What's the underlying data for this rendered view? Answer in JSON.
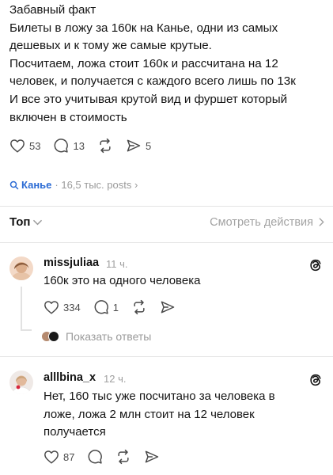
{
  "post": {
    "lines": [
      "Забавный факт",
      "Билеты в ложу за 160к на Канье, одни из самых",
      "дешевых и к тому же самые крутые.",
      "Посчитаем, ложа стоит 160к и рассчитана на 12",
      "человек, и получается с каждого всего лишь по 13к",
      "И все это учитывая крутой вид и фуршет который",
      "включен в стоимость"
    ],
    "likes": "53",
    "replies": "13",
    "shares": "5"
  },
  "topic": {
    "name": "Канье",
    "meta": "· 16,5 тыс. posts ›"
  },
  "sort": {
    "label": "Топ",
    "view_activity": "Смотреть действия"
  },
  "replies": [
    {
      "username": "missjuliaa",
      "time": "11 ч.",
      "text": [
        "160к это на одного человека"
      ],
      "likes": "334",
      "replies": "1",
      "view_replies": "Показать ответы"
    },
    {
      "username": "alllbina_x",
      "time": "12 ч.",
      "text": [
        "Нет, 160 тыс уже посчитано за человека в",
        "ложе, ложа 2 млн стоит на 12 человек",
        "получается"
      ],
      "likes": "87"
    }
  ],
  "icons": {
    "like": "heart-icon",
    "reply": "comment-icon",
    "repost": "repost-icon",
    "share": "send-icon",
    "threads": "threads-logo-icon",
    "search": "search-icon"
  },
  "colors": {
    "accent": "#2b6bd4",
    "muted": "#9a9a9a"
  }
}
